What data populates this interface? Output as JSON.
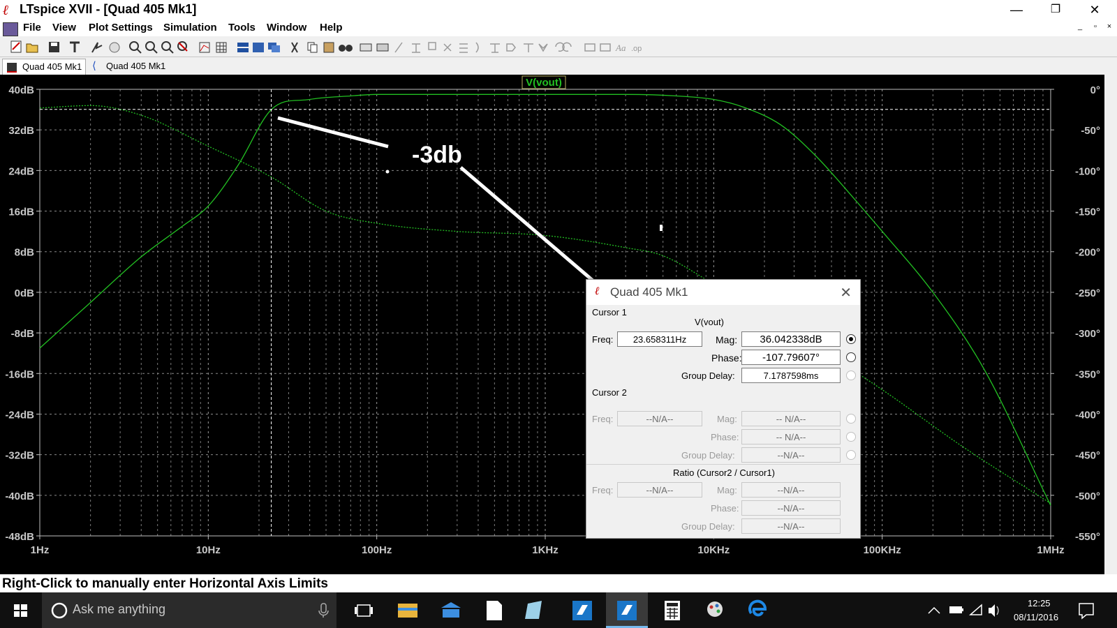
{
  "window": {
    "title": "LTspice XVII - [Quad 405 Mk1]",
    "minimize": "—",
    "maximize": "❐",
    "close": "✕"
  },
  "menu": [
    "File",
    "View",
    "Plot Settings",
    "Simulation",
    "Tools",
    "Window",
    "Help"
  ],
  "tabs": [
    "Quad 405 Mk1",
    "Quad 405 Mk1"
  ],
  "plot": {
    "trace_label": "V(vout)",
    "annotation": "-3db",
    "trace_color": "#22c022",
    "left_ticks": [
      "40dB",
      "32dB",
      "24dB",
      "16dB",
      "8dB",
      "0dB",
      "-8dB",
      "-16dB",
      "-24dB",
      "-32dB",
      "-40dB",
      "-48dB"
    ],
    "right_ticks": [
      "0°",
      "-50°",
      "-100°",
      "-150°",
      "-200°",
      "-250°",
      "-300°",
      "-350°",
      "-400°",
      "-450°",
      "-500°",
      "-550°"
    ],
    "x_ticks": [
      "1Hz",
      "10Hz",
      "100Hz",
      "1KHz",
      "10KHz",
      "100KHz",
      "1MHz"
    ]
  },
  "chart_data": {
    "type": "line",
    "xscale": "log",
    "xlim": [
      1,
      1000000
    ],
    "ylim_left": [
      -48,
      40
    ],
    "ylim_right": [
      -550,
      0
    ],
    "series": [
      {
        "name": "V(vout)",
        "axis": "magnitude",
        "style": "solid",
        "x": [
          1,
          2,
          4,
          7,
          10,
          15,
          23.66,
          40,
          70,
          100,
          300,
          1000,
          3000,
          6000,
          10000,
          15000,
          25000,
          40000,
          70000,
          100000,
          200000,
          400000,
          1000000
        ],
        "y": [
          -11,
          -2,
          7,
          13,
          17,
          25,
          36,
          38,
          38.7,
          39,
          39,
          39,
          39,
          38.7,
          38,
          36.5,
          33,
          27,
          18,
          12,
          0,
          -15,
          -42
        ]
      },
      {
        "name": "V(vout)",
        "axis": "phase",
        "style": "dotted",
        "x": [
          1,
          2,
          4,
          10,
          23.66,
          50,
          100,
          300,
          1000,
          3000,
          5000,
          10000,
          30000,
          100000,
          300000,
          1000000
        ],
        "y": [
          -23,
          -20,
          -32,
          -70,
          -108,
          -150,
          -165,
          -175,
          -180,
          -195,
          -205,
          -240,
          -300,
          -370,
          -440,
          -510
        ]
      }
    ]
  },
  "cursor_dialog": {
    "title": "Quad 405 Mk1",
    "cursor1_label": "Cursor 1",
    "trace": "V(vout)",
    "freq_label": "Freq:",
    "mag_label": "Mag:",
    "phase_label": "Phase:",
    "group_delay_label": "Group Delay:",
    "freq": "23.658311Hz",
    "mag": "36.042338dB",
    "phase": "-107.79607°",
    "group_delay": "7.1787598ms",
    "cursor2_label": "Cursor 2",
    "na": "-- N/A--",
    "na2": "--N/A--",
    "ratio_label": "Ratio (Cursor2 / Cursor1)"
  },
  "status_text": "Right-Click to manually enter Horizontal Axis Limits",
  "taskbar": {
    "search_placeholder": "Ask me anything",
    "time": "12:25",
    "date": "08/11/2016"
  }
}
